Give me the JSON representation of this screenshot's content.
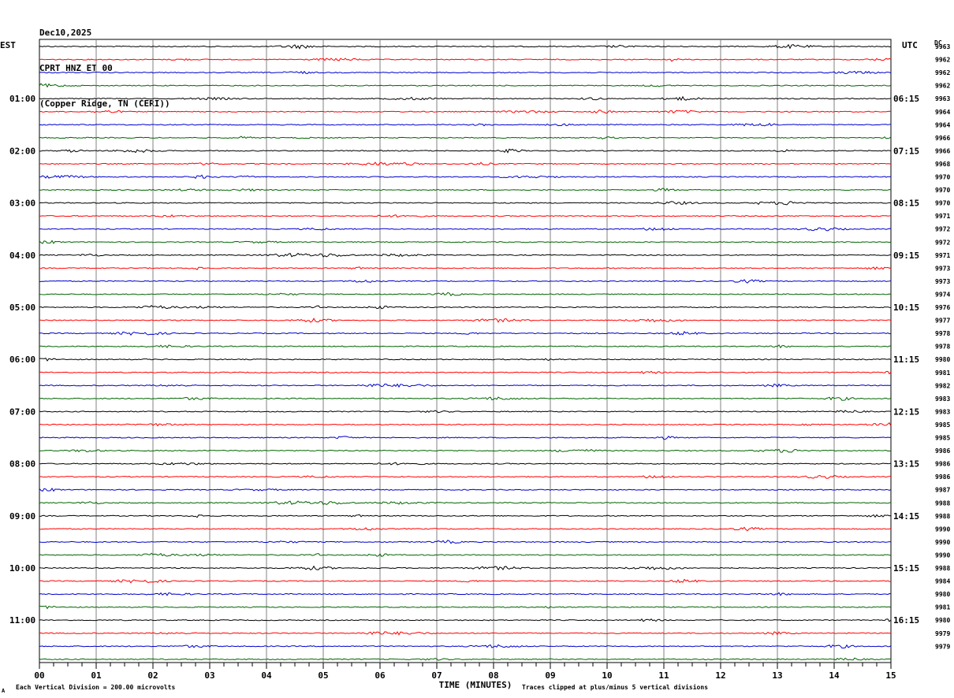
{
  "header": {
    "date": "Dec10,2025",
    "station": "CPRT HNZ ET 00",
    "location": "(Copper Ridge, TN (CERI))"
  },
  "left_zone_label": "EST",
  "right_zone_label": "UTC",
  "dc_label": "DC",
  "footer": {
    "scale_note": "Each Vertical Division =  200.00 microvolts",
    "clip_note": "Traces clipped at plus/minus 5 vertical divisions",
    "corner_mark": "A"
  },
  "colors": {
    "trace_cycle": [
      "#000000",
      "#ff0000",
      "#0000cc",
      "#006400"
    ],
    "grid": "#808080"
  },
  "chart_data": {
    "type": "line",
    "title": "",
    "xlabel": "TIME (MINUTES)",
    "xlim": [
      0,
      15
    ],
    "x_ticks": [
      "00",
      "01",
      "02",
      "03",
      "04",
      "05",
      "06",
      "07",
      "08",
      "09",
      "10",
      "11",
      "12",
      "13",
      "14",
      "15"
    ],
    "rows_per_hour": 4,
    "est_hour_labels": [
      "01:00",
      "02:00",
      "03:00",
      "04:00",
      "05:00",
      "06:00",
      "07:00",
      "08:00",
      "09:00",
      "10:00",
      "11:00"
    ],
    "utc_hour_labels": [
      "06:15",
      "07:15",
      "08:15",
      "09:15",
      "10:15",
      "11:15",
      "12:15",
      "13:15",
      "14:15",
      "15:15",
      "16:15"
    ],
    "dc_values": [
      "9963",
      "9962",
      "9962",
      "9962",
      "9963",
      "9964",
      "9964",
      "9966",
      "9966",
      "9968",
      "9970",
      "9970",
      "9970",
      "9971",
      "9972",
      "9972",
      "9971",
      "9973",
      "9973",
      "9974",
      "9976",
      "9977",
      "9978",
      "9978",
      "9980",
      "9981",
      "9982",
      "9983",
      "9983",
      "9985",
      "9985",
      "9986",
      "9986",
      "9986",
      "9987",
      "9988",
      "9988",
      "9990",
      "9990",
      "9990",
      "9988",
      "9984",
      "9980",
      "9981",
      "9980",
      "9979",
      "9979"
    ]
  }
}
